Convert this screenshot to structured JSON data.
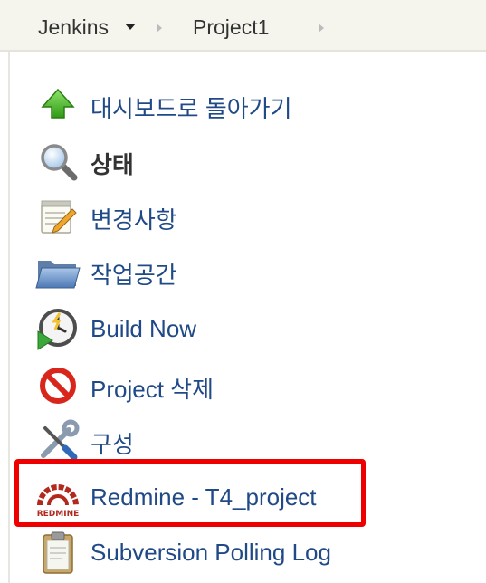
{
  "breadcrumb": {
    "root": "Jenkins",
    "project": "Project1"
  },
  "tasks": [
    {
      "label": "대시보드로 돌아가기",
      "icon": "up-arrow-icon"
    },
    {
      "label": "상태",
      "icon": "magnifier-icon",
      "current": true
    },
    {
      "label": "변경사항",
      "icon": "notepad-icon"
    },
    {
      "label": "작업공간",
      "icon": "folder-icon"
    },
    {
      "label": "Build Now",
      "icon": "clock-play-icon"
    },
    {
      "label": "Project 삭제",
      "icon": "no-entry-icon"
    },
    {
      "label": "구성",
      "icon": "wrench-screwdriver-icon"
    },
    {
      "label": "Redmine - T4_project",
      "icon": "redmine-logo-icon"
    },
    {
      "label": "Subversion Polling Log",
      "icon": "clipboard-icon"
    }
  ],
  "redmine_logo_text": "REDMINE",
  "colors": {
    "link": "#204a87",
    "highlight": "#ee0000",
    "breadcrumb_bg": "#f5f5ee"
  }
}
